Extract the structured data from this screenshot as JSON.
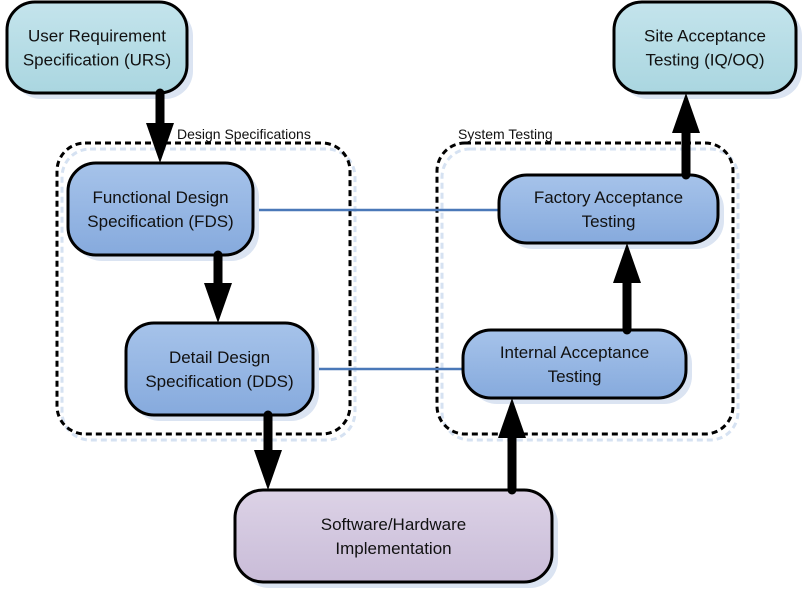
{
  "colors": {
    "requirement_fill": "#b6dce6",
    "design_fill": "#8fb2e0",
    "implementation_fill": "#cfc3dc",
    "link_line": "#4a78b8",
    "arrow": "#000000"
  },
  "groups": {
    "design": {
      "label": "Design Specifications"
    },
    "testing": {
      "label": "System Testing"
    }
  },
  "nodes": {
    "urs": {
      "lines": [
        "User Requirement",
        "Specification (URS)"
      ]
    },
    "fds": {
      "lines": [
        "Functional Design",
        "Specification (FDS)"
      ]
    },
    "dds": {
      "lines": [
        "Detail Design",
        "Specification (DDS)"
      ]
    },
    "impl": {
      "lines": [
        "Software/Hardware",
        "Implementation"
      ]
    },
    "iat": {
      "lines": [
        "Internal Acceptance",
        "Testing"
      ]
    },
    "fat": {
      "lines": [
        "Factory Acceptance",
        "Testing"
      ]
    },
    "sat": {
      "lines": [
        "Site Acceptance",
        "Testing (IQ/OQ)"
      ]
    }
  },
  "arrows": [
    {
      "from": "urs",
      "to": "fds"
    },
    {
      "from": "fds",
      "to": "dds"
    },
    {
      "from": "dds",
      "to": "impl"
    },
    {
      "from": "impl",
      "to": "iat"
    },
    {
      "from": "iat",
      "to": "fat"
    },
    {
      "from": "fat",
      "to": "sat"
    }
  ],
  "links": [
    {
      "from": "fds",
      "to": "fat"
    },
    {
      "from": "dds",
      "to": "iat"
    }
  ]
}
